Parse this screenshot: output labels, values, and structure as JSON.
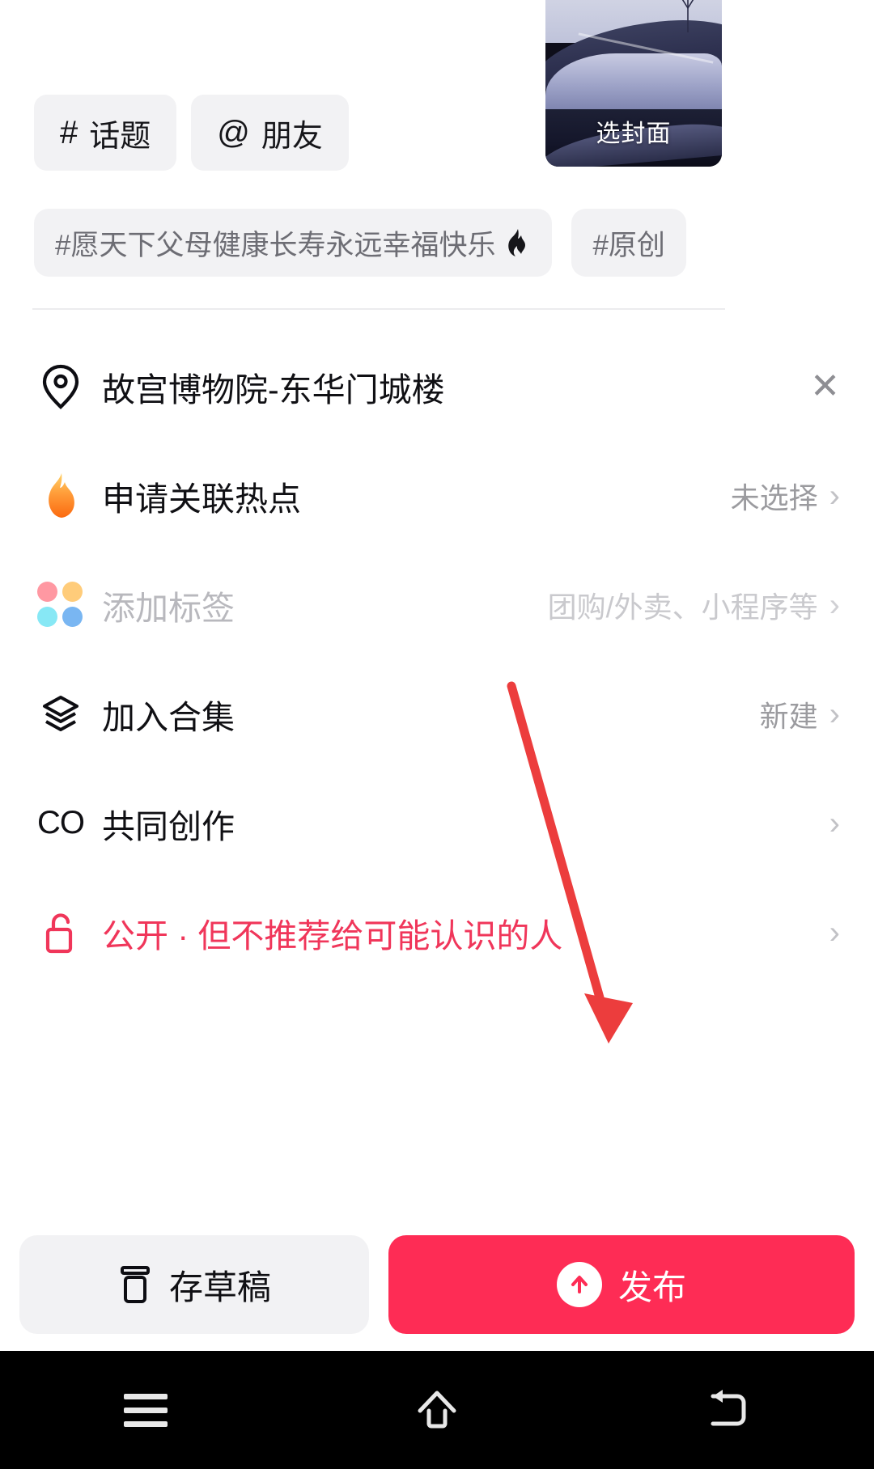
{
  "cover": {
    "label": "选封面",
    "image_desc": "horse-rider-silhouette-snow-dunes"
  },
  "chips": [
    {
      "symbol": "#",
      "label": "话题",
      "name": "topic-chip"
    },
    {
      "symbol": "@",
      "label": "朋友",
      "name": "mention-chip"
    }
  ],
  "hashtag_suggestions": [
    {
      "text": "#愿天下父母健康长寿永远幸福快乐",
      "hot": true,
      "flame": "🔥"
    },
    {
      "text": "#原创",
      "hot": false,
      "flame": ""
    }
  ],
  "list": {
    "location": {
      "label": "故宫博物院-东华门城楼",
      "close": "✕",
      "icon": "location-pin-icon"
    },
    "hotspot": {
      "label": "申请关联热点",
      "value": "未选择",
      "chevron": "›",
      "icon": "flame-icon"
    },
    "tags": {
      "label": "添加标签",
      "value": "团购/外卖、小程序等",
      "chevron": "›",
      "icon": "color-dots-icon",
      "disabled": true
    },
    "collection": {
      "label": "加入合集",
      "value": "新建",
      "chevron": "›",
      "icon": "layers-icon"
    },
    "coauthor": {
      "label": "共同创作",
      "value": "",
      "chevron": "›",
      "icon": "co-icon",
      "icon_text": "CO"
    },
    "privacy": {
      "label": "公开 · 但不推荐给可能认识的人",
      "value": "",
      "chevron": "›",
      "icon": "unlock-icon"
    }
  },
  "bottom": {
    "draft_label": "存草稿",
    "publish_label": "发布",
    "publish_arrow": "↑"
  },
  "navbar": {
    "recents": "recents-icon",
    "home": "home-icon",
    "back": "back-icon"
  },
  "colors": {
    "accent_red": "#fe2c55",
    "privacy_red": "#f0365a",
    "chip_bg": "#f2f2f4",
    "muted_text": "#9b9b9f",
    "annotation_red": "#ec3d3d"
  },
  "annotation": {
    "type": "arrow",
    "description": "red arrow pointing to publish button"
  }
}
